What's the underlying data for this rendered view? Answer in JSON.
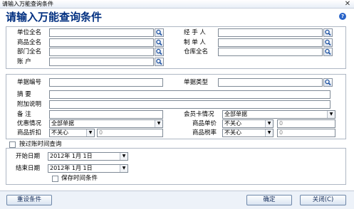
{
  "window": {
    "title": "请输入万能查询条件",
    "close_glyph": "✕"
  },
  "heading": "请输入万能查询条件",
  "help_glyph": "?",
  "section1": {
    "unit_label": "单位全名",
    "handler_label": "经 手 人",
    "goods_label": "商品全名",
    "maker_label": "制 单 人",
    "dept_label": "部门全名",
    "warehouse_label": "仓库全名",
    "account_label": "账    户"
  },
  "section2": {
    "bill_no_label": "单据编号",
    "bill_type_label": "单据类型",
    "summary_label": "摘    要",
    "extra_label": "附加说明",
    "remark_label": "备    注",
    "member_card_label": "会员卡情况",
    "member_card_value": "全部单据",
    "discount_label": "优惠情况",
    "discount_value": "全部单据",
    "unit_price_label": "商品单价",
    "unit_price_op": "不关心",
    "unit_price_value": "0",
    "goods_discount_label": "商品折扣",
    "goods_discount_op": "不关心",
    "goods_discount_value": "0",
    "tax_rate_label": "商品税率",
    "tax_rate_op": "不关心",
    "tax_rate_value": "0"
  },
  "account_time_query_label": "按过账时间查询",
  "section3": {
    "start_label": "开始日期",
    "start_value": "2012年 1月 1日",
    "end_label": "结束日期",
    "end_value": "2012年 1月 1日",
    "save_time_label": "保存时间条件"
  },
  "buttons": {
    "reset": "重设条件",
    "ok": "确定",
    "close": "关闭(C)"
  }
}
